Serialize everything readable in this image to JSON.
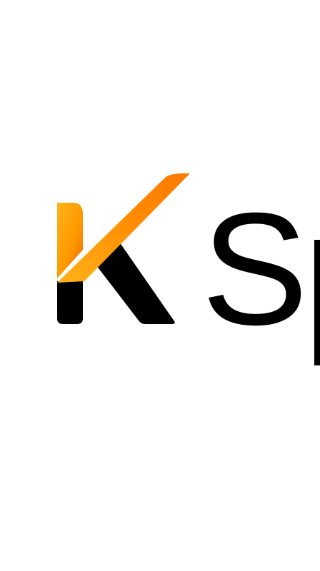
{
  "splash": {
    "logo_text": "KS",
    "brand_colors": {
      "primary_orange": "#FF8A00",
      "light_orange": "#FFB21A",
      "dark_orange": "#F06A00",
      "ink": "#000000",
      "background": "#FFFFFF"
    }
  }
}
